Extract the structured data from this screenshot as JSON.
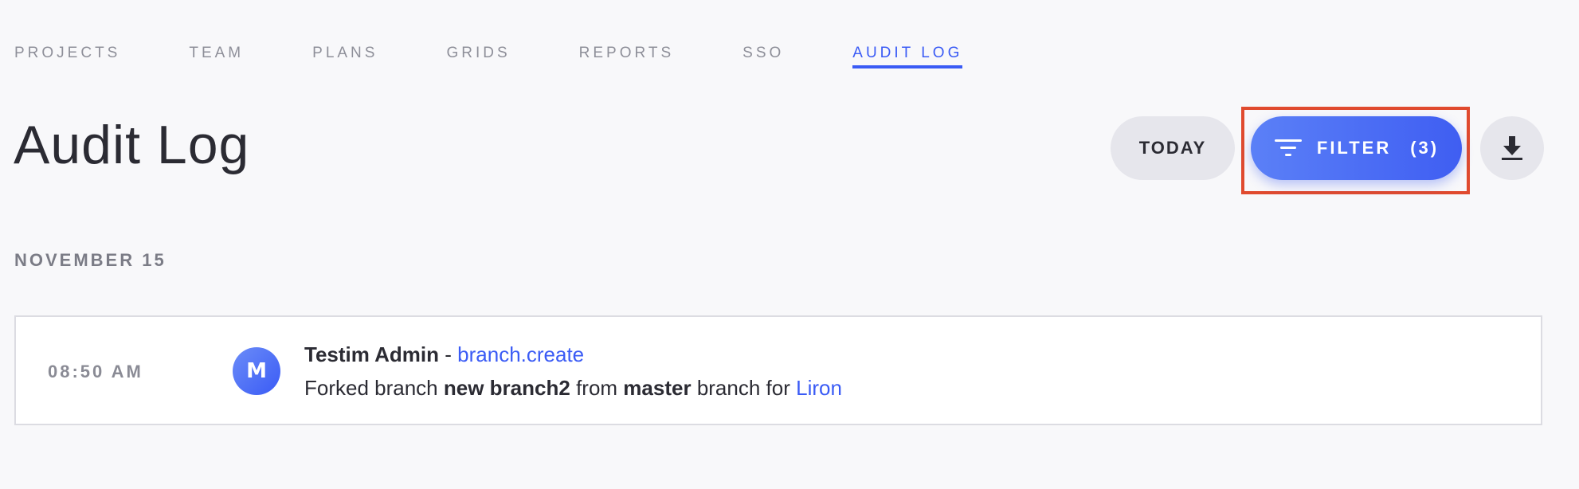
{
  "nav": {
    "tabs": [
      "PROJECTS",
      "TEAM",
      "PLANS",
      "GRIDS",
      "REPORTS",
      "SSO",
      "AUDIT LOG"
    ],
    "active": "AUDIT LOG"
  },
  "page": {
    "title": "Audit Log"
  },
  "toolbar": {
    "today_label": "TODAY",
    "filter_label": "FILTER",
    "filter_count": "(3)",
    "accent": "#3a5bf5",
    "highlight_color": "#e04a2e"
  },
  "log": {
    "date_heading": "NOVEMBER 15",
    "entries": [
      {
        "time": "08:50 AM",
        "avatar_letter": "M",
        "user": "Testim Admin",
        "separator": "-",
        "event": "branch.create",
        "msg_prefix": "Forked branch",
        "branch_name": "new branch2",
        "msg_from": "from",
        "source_branch": "master",
        "msg_suffix": "branch for",
        "target_user": "Liron"
      }
    ]
  }
}
